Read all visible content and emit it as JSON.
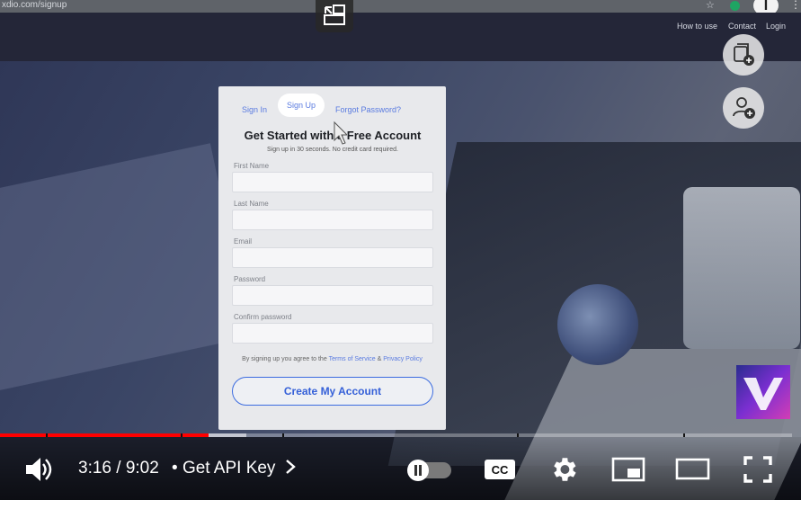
{
  "browser": {
    "url": "xdio.com/signup",
    "profile_initial": "I"
  },
  "site_nav": {
    "how_to_use": "How to use",
    "contact": "Contact",
    "login": "Login"
  },
  "signup_card": {
    "tabs": {
      "sign_in": "Sign In",
      "sign_up": "Sign Up",
      "forgot": "Forgot Password?"
    },
    "title": "Get Started with a Free Account",
    "subtitle": "Sign up in 30 seconds. No credit card required.",
    "fields": {
      "first_name": "First Name",
      "last_name": "Last Name",
      "email": "Email",
      "password": "Password",
      "confirm_password": "Confirm password"
    },
    "terms_prefix": "By signing up you agree to the",
    "terms_link": "Terms of Service",
    "terms_amp": "&",
    "privacy_link": "Privacy Policy",
    "create_button": "Create My Account"
  },
  "player": {
    "time": "3:16 / 9:02",
    "chapter_bullet": "•",
    "chapter": "Get API Key",
    "cc_label": "CC",
    "progress_played_fraction": 0.263,
    "progress_loaded_fraction": 0.311
  },
  "colors": {
    "progress_red": "#ff0000",
    "link_blue": "#5a7be0"
  }
}
